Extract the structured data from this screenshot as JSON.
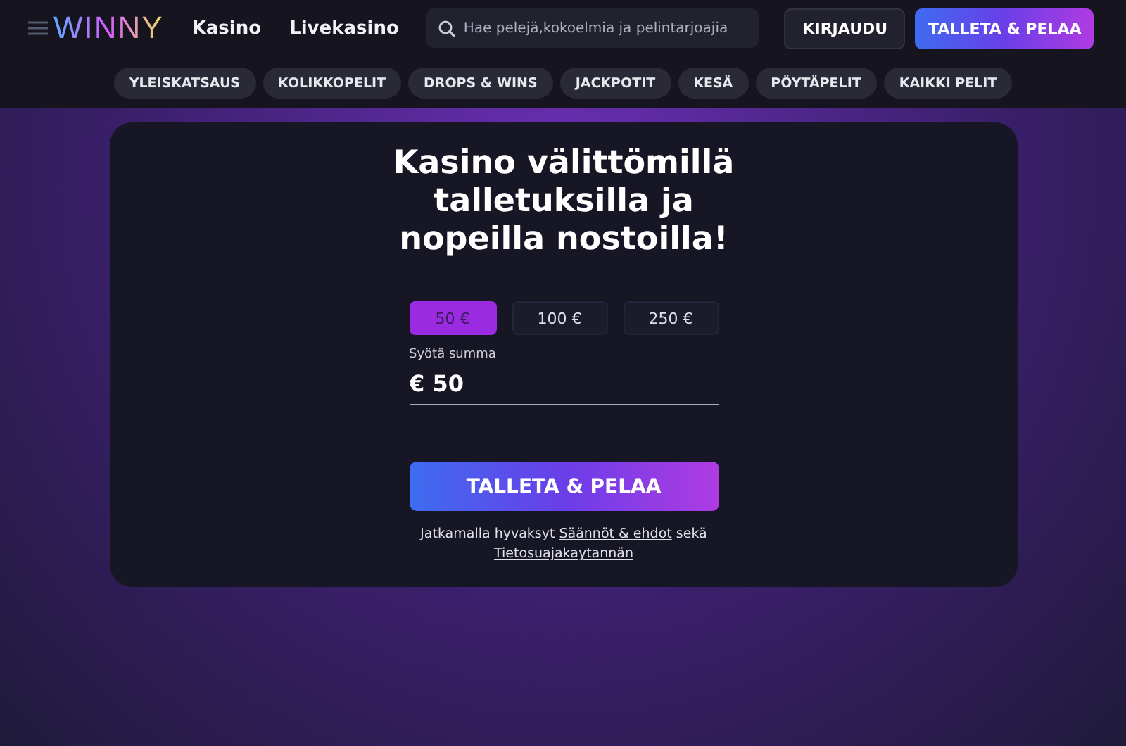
{
  "header": {
    "logo": "WINNY",
    "nav": [
      "Kasino",
      "Livekasino"
    ],
    "search": {
      "placeholder": "Hae pelejä,kokoelmia ja pelintarjoajia"
    },
    "login": "KIRJAUDU",
    "deposit": "TALLETA & PELAA"
  },
  "categories": [
    {
      "label": "YLEISKATSAUS"
    },
    {
      "label": "KOLIKKOPELIT"
    },
    {
      "label": "DROPS & WINS"
    },
    {
      "label": "JACKPOTIT"
    },
    {
      "label": "KESÄ"
    },
    {
      "label": "PÖYTÄPELIT"
    },
    {
      "label": "KAIKKI PELIT"
    }
  ],
  "card": {
    "title": "Kasino välittömillä talletuksilla ja nopeilla nostoilla!",
    "amounts": [
      {
        "label": "50 €",
        "selected": true
      },
      {
        "label": "100 €",
        "selected": false
      },
      {
        "label": "250 €",
        "selected": false
      }
    ],
    "field_label": "Syötä summa",
    "value": "€ 50",
    "submit": "TALLETA & PELAA",
    "terms": {
      "prefix": "Jatkamalla hyvaksyt",
      "link_1": "Säännöt & ehdot",
      "middle": "sekä",
      "link_2": "Tietosuajakaytannän"
    }
  }
}
